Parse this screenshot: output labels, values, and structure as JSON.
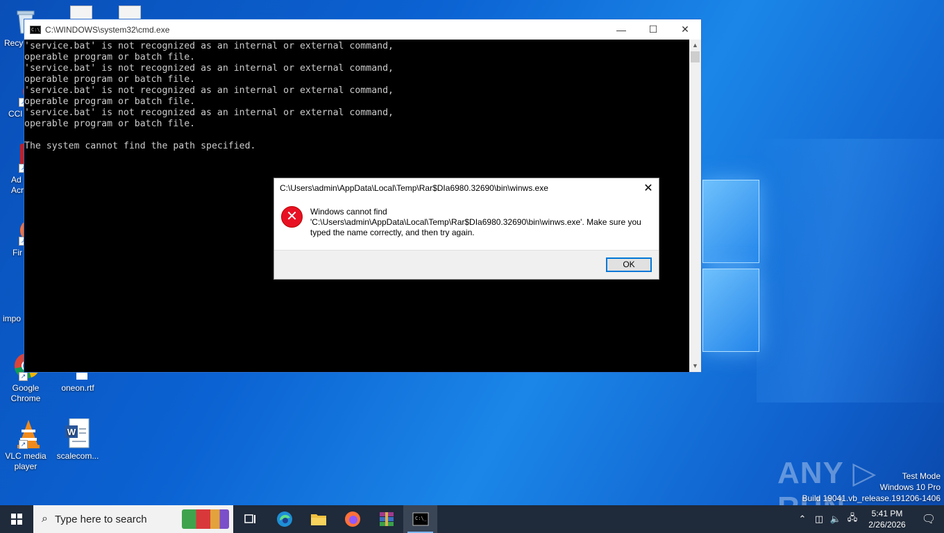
{
  "desktop": {
    "icons": [
      {
        "label": "Recy",
        "icon": "recycle-bin-icon"
      },
      {
        "label": "CCl",
        "icon": "ccleaner-icon"
      },
      {
        "label": "Ad\nAcr",
        "icon": "acrobat-icon"
      },
      {
        "label": "Fir",
        "icon": "firefox-icon"
      },
      {
        "label": "impo",
        "icon": "document-icon"
      },
      {
        "label": "Google\nChrome",
        "icon": "chrome-icon"
      },
      {
        "label": "oneon.rtf",
        "icon": "rtf-document-icon"
      },
      {
        "label": "VLC media\nplayer",
        "icon": "vlc-icon"
      },
      {
        "label": "scalecom...",
        "icon": "word-document-icon"
      }
    ]
  },
  "cmd_window": {
    "title": "C:\\WINDOWS\\system32\\cmd.exe",
    "output": "'service.bat' is not recognized as an internal or external command,\noperable program or batch file.\n'service.bat' is not recognized as an internal or external command,\noperable program or batch file.\n'service.bat' is not recognized as an internal or external command,\noperable program or batch file.\n'service.bat' is not recognized as an internal or external command,\noperable program or batch file.\n\nThe system cannot find the path specified.",
    "minimize_glyph": "—",
    "maximize_glyph": "☐",
    "close_glyph": "✕"
  },
  "error_dialog": {
    "title": "C:\\Users\\admin\\AppData\\Local\\Temp\\Rar$DIa6980.32690\\bin\\winws.exe",
    "message_line1": "Windows cannot find",
    "message_line2": "'C:\\Users\\admin\\AppData\\Local\\Temp\\Rar$DIa6980.32690\\bin\\winws.exe'. Make sure you",
    "message_line3": "typed the name correctly, and then try again.",
    "ok_label": "OK",
    "close_glyph": "✕",
    "icon": "error-icon"
  },
  "watermark": {
    "brand": "ANY ▷ RUN",
    "mode": "Test Mode",
    "edition": "Windows 10 Pro",
    "build": "Build 19041.vb_release.191206-1406"
  },
  "taskbar": {
    "search_placeholder": "Type here to search",
    "time": "5:41 PM",
    "date": "2/26/2026",
    "colors": {
      "bar": "#1f2a3a",
      "accent": "#0078d7"
    }
  }
}
